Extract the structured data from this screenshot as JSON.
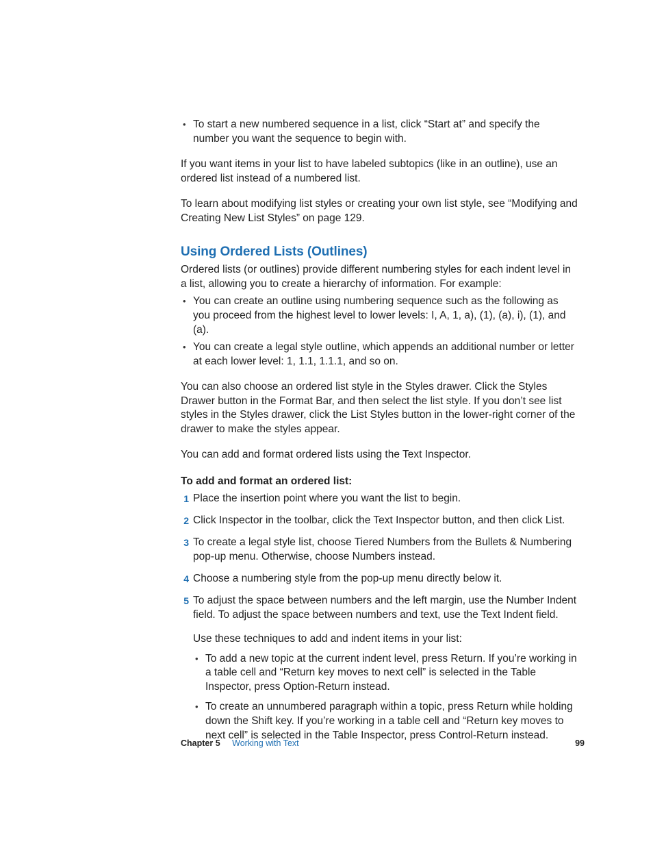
{
  "topBullets": [
    "To start a new numbered sequence in a list, click “Start at” and specify the number you want the sequence to begin with."
  ],
  "para1": "If you want items in your list to have labeled subtopics (like in an outline), use an ordered list instead of a numbered list.",
  "para2": "To learn about modifying list styles or creating your own list style, see “Modifying and Creating New List Styles” on page 129.",
  "heading": "Using Ordered Lists (Outlines)",
  "intro": "Ordered lists (or outlines) provide different numbering styles for each indent level in a list, allowing you to create a hierarchy of information. For example:",
  "introBullets": [
    "You can create an outline using numbering sequence such as the following as you proceed from the highest level to lower levels: I, A, 1, a), (1), (a), i), (1), and (a).",
    "You can create a legal style outline, which appends an additional number or letter at each lower level: 1, 1.1, 1.1.1, and so on."
  ],
  "para3": "You can also choose an ordered list style in the Styles drawer. Click the Styles Drawer button in the Format Bar, and then select the list style. If you don’t see list styles in the Styles drawer, click the List Styles button in the lower-right corner of the drawer to make the styles appear.",
  "para4": "You can add and format ordered lists using the Text Inspector.",
  "stepsTitle": "To add and format an ordered list:",
  "steps": [
    {
      "n": "1",
      "t": "Place the insertion point where you want the list to begin."
    },
    {
      "n": "2",
      "t": "Click Inspector in the toolbar, click the Text Inspector button, and then click List."
    },
    {
      "n": "3",
      "t": "To create a legal style list, choose Tiered Numbers from the Bullets & Numbering pop-up menu. Otherwise, choose Numbers instead."
    },
    {
      "n": "4",
      "t": "Choose a numbering style from the pop-up menu directly below it."
    },
    {
      "n": "5",
      "t": "To adjust the space between numbers and the left margin, use the Number Indent field. To adjust the space between numbers and text, use the Text Indent field."
    }
  ],
  "subPara": "Use these techniques to add and indent items in your list:",
  "subBullets": [
    "To add a new topic at the current indent level, press Return. If you’re working in a table cell and “Return key moves to next cell” is selected in the Table Inspector, press Option-Return instead.",
    "To create an unnumbered paragraph within a topic, press Return while holding down the Shift key. If you’re working in a table cell and “Return key moves to next cell” is selected in the Table Inspector, press Control-Return instead."
  ],
  "footer": {
    "chapterLabel": "Chapter 5",
    "chapterName": "Working with Text",
    "page": "99"
  }
}
